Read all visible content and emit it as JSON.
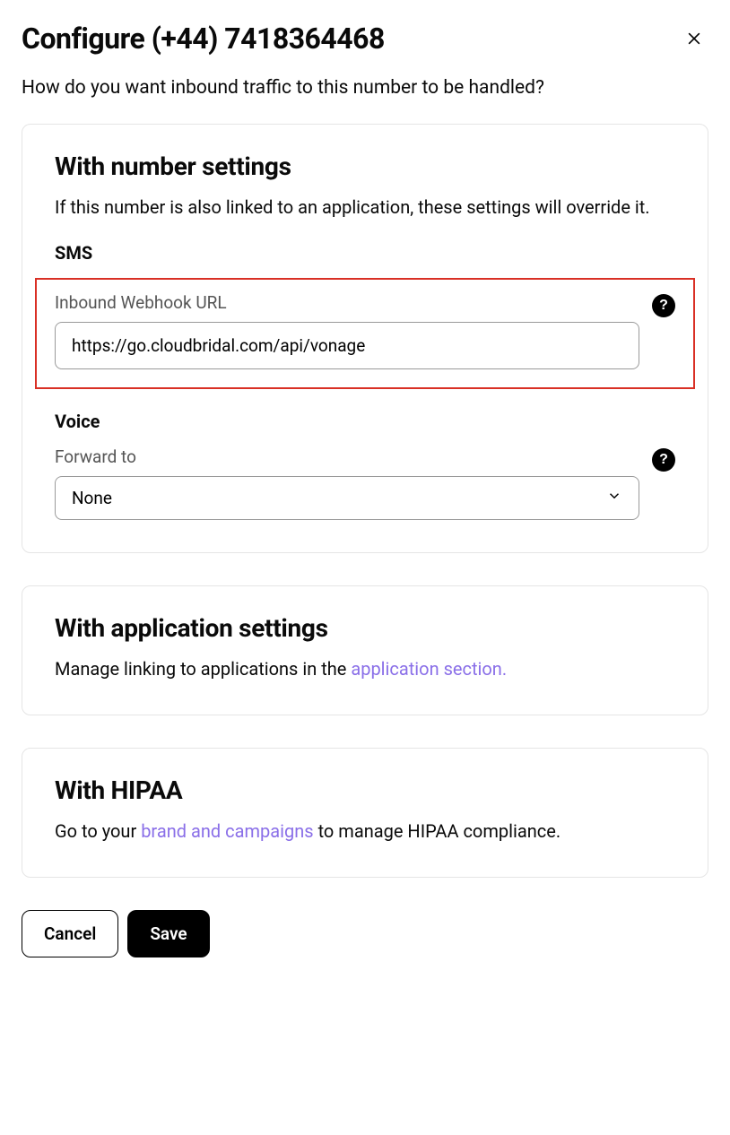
{
  "header": {
    "title": "Configure (+44) 7418364468"
  },
  "subtitle": "How do you want inbound traffic to this number to be handled?",
  "panels": {
    "number_settings": {
      "heading": "With number settings",
      "desc": "If this number is also linked to an application, these settings will override it.",
      "sms": {
        "section_label": "SMS",
        "webhook_label": "Inbound Webhook URL",
        "webhook_value": "https://go.cloudbridal.com/api/vonage"
      },
      "voice": {
        "section_label": "Voice",
        "forward_label": "Forward to",
        "forward_value": "None"
      }
    },
    "app_settings": {
      "heading": "With application settings",
      "desc_prefix": "Manage linking to applications in the ",
      "link_text": "application section.",
      "desc_suffix": ""
    },
    "hipaa": {
      "heading": "With HIPAA",
      "desc_prefix": "Go to your ",
      "link_text": "brand and campaigns",
      "desc_suffix": " to manage HIPAA compliance."
    }
  },
  "buttons": {
    "cancel": "Cancel",
    "save": "Save"
  },
  "help_glyph": "?"
}
